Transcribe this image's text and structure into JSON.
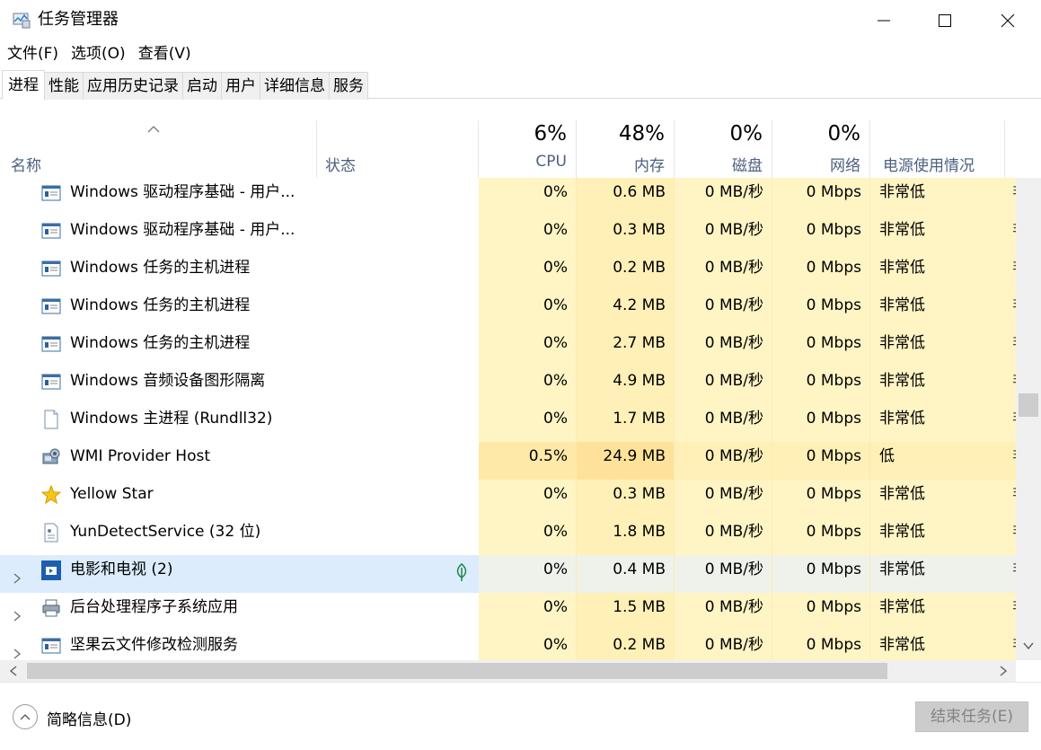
{
  "window": {
    "title": "任务管理器",
    "icon": "task-manager-icon"
  },
  "menu": [
    "文件(F)",
    "选项(O)",
    "查看(V)"
  ],
  "tabs": [
    "进程",
    "性能",
    "应用历史记录",
    "启动",
    "用户",
    "详细信息",
    "服务"
  ],
  "header": {
    "name": "名称",
    "status": "状态",
    "cpu_pct": "6%",
    "cpu": "CPU",
    "mem_pct": "48%",
    "mem": "内存",
    "disk_pct": "0%",
    "disk": "磁盘",
    "net_pct": "0%",
    "net": "网络",
    "power": "电源使用情况",
    "power_trend": "电源"
  },
  "rows": [
    {
      "name": "Windows 驱动程序基础 - 用户...",
      "icon": "window-app-icon",
      "cpu": "0%",
      "mem": "0.6 MB",
      "disk": "0 MB/秒",
      "net": "0 Mbps",
      "power": "非常低",
      "expandable": false
    },
    {
      "name": "Windows 驱动程序基础 - 用户...",
      "icon": "window-app-icon",
      "cpu": "0%",
      "mem": "0.3 MB",
      "disk": "0 MB/秒",
      "net": "0 Mbps",
      "power": "非常低",
      "expandable": false
    },
    {
      "name": "Windows 任务的主机进程",
      "icon": "window-app-icon",
      "cpu": "0%",
      "mem": "0.2 MB",
      "disk": "0 MB/秒",
      "net": "0 Mbps",
      "power": "非常低",
      "expandable": false
    },
    {
      "name": "Windows 任务的主机进程",
      "icon": "window-app-icon",
      "cpu": "0%",
      "mem": "4.2 MB",
      "disk": "0 MB/秒",
      "net": "0 Mbps",
      "power": "非常低",
      "expandable": false
    },
    {
      "name": "Windows 任务的主机进程",
      "icon": "window-app-icon",
      "cpu": "0%",
      "mem": "2.7 MB",
      "disk": "0 MB/秒",
      "net": "0 Mbps",
      "power": "非常低",
      "expandable": false
    },
    {
      "name": "Windows 音频设备图形隔离",
      "icon": "window-app-icon",
      "cpu": "0%",
      "mem": "4.9 MB",
      "disk": "0 MB/秒",
      "net": "0 Mbps",
      "power": "非常低",
      "expandable": false
    },
    {
      "name": "Windows 主进程 (Rundll32)",
      "icon": "document-icon",
      "cpu": "0%",
      "mem": "1.7 MB",
      "disk": "0 MB/秒",
      "net": "0 Mbps",
      "power": "非常低",
      "expandable": false
    },
    {
      "name": "WMI Provider Host",
      "icon": "wmi-host-icon",
      "cpu": "0.5%",
      "mem": "24.9 MB",
      "disk": "0 MB/秒",
      "net": "0 Mbps",
      "power": "低",
      "expandable": false,
      "hot": true
    },
    {
      "name": "Yellow Star",
      "icon": "star-icon",
      "cpu": "0%",
      "mem": "0.3 MB",
      "disk": "0 MB/秒",
      "net": "0 Mbps",
      "power": "非常低",
      "expandable": false
    },
    {
      "name": "YunDetectService (32 位)",
      "icon": "service-doc-icon",
      "cpu": "0%",
      "mem": "1.8 MB",
      "disk": "0 MB/秒",
      "net": "0 Mbps",
      "power": "非常低",
      "expandable": false
    },
    {
      "name": "电影和电视 (2)",
      "icon": "movies-tv-icon",
      "cpu": "0%",
      "mem": "0.4 MB",
      "disk": "0 MB/秒",
      "net": "0 Mbps",
      "power": "非常低",
      "expandable": true,
      "selected": true,
      "suspended_icon": "leaf-icon"
    },
    {
      "name": "后台处理程序子系统应用",
      "icon": "printer-icon",
      "cpu": "0%",
      "mem": "1.5 MB",
      "disk": "0 MB/秒",
      "net": "0 Mbps",
      "power": "非常低",
      "expandable": true
    },
    {
      "name": "坚果云文件修改检测服务",
      "icon": "window-app-icon",
      "cpu": "0%",
      "mem": "0.2 MB",
      "disk": "0 MB/秒",
      "net": "0 Mbps",
      "power": "非常低",
      "expandable": true
    }
  ],
  "power_trend_glyph": "非",
  "footer": {
    "fewer_details": "简略信息(D)",
    "end_task": "结束任务(E)"
  }
}
